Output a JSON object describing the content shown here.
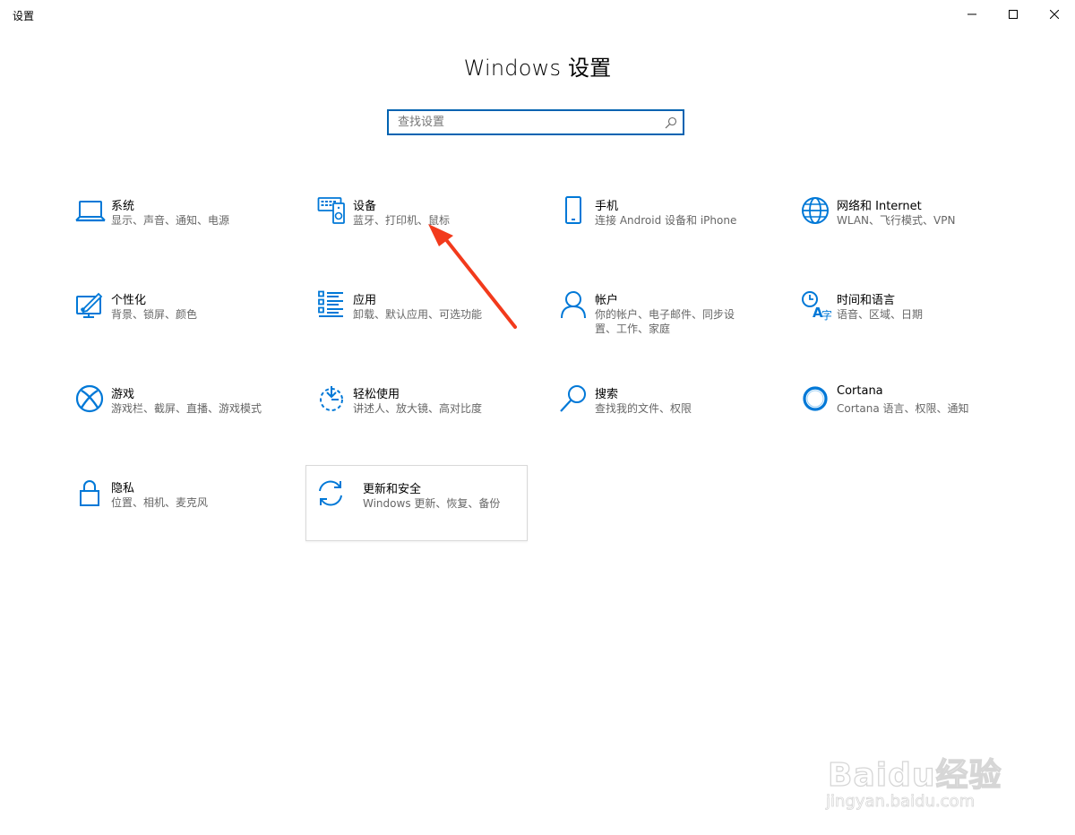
{
  "window": {
    "app_title": "设置"
  },
  "header": {
    "title": "Windows 设置"
  },
  "search": {
    "placeholder": "查找设置",
    "value": ""
  },
  "tiles": [
    {
      "title": "系统",
      "desc": "显示、声音、通知、电源",
      "icon": "laptop-icon"
    },
    {
      "title": "设备",
      "desc": "蓝牙、打印机、鼠标",
      "icon": "devices-icon"
    },
    {
      "title": "手机",
      "desc": "连接 Android 设备和 iPhone",
      "icon": "phone-icon"
    },
    {
      "title": "网络和 Internet",
      "desc": "WLAN、飞行模式、VPN",
      "icon": "globe-icon"
    },
    {
      "title": "个性化",
      "desc": "背景、锁屏、颜色",
      "icon": "personalization-icon"
    },
    {
      "title": "应用",
      "desc": "卸载、默认应用、可选功能",
      "icon": "apps-list-icon"
    },
    {
      "title": "帐户",
      "desc": "你的帐户、电子邮件、同步设置、工作、家庭",
      "icon": "person-icon"
    },
    {
      "title": "时间和语言",
      "desc": "语音、区域、日期",
      "icon": "time-language-icon"
    },
    {
      "title": "游戏",
      "desc": "游戏栏、截屏、直播、游戏模式",
      "icon": "xbox-icon"
    },
    {
      "title": "轻松使用",
      "desc": "讲述人、放大镜、高对比度",
      "icon": "ease-of-access-icon"
    },
    {
      "title": "搜索",
      "desc": "查找我的文件、权限",
      "icon": "magnifier-icon"
    },
    {
      "title": "Cortana",
      "desc": "Cortana 语言、权限、通知",
      "icon": "cortana-icon"
    },
    {
      "title": "隐私",
      "desc": "位置、相机、麦克风",
      "icon": "lock-icon"
    },
    {
      "title": "更新和安全",
      "desc": "Windows 更新、恢复、备份",
      "icon": "sync-icon"
    }
  ],
  "watermark": {
    "brand": "Baidu经验",
    "url": "jingyan.baidu.com"
  },
  "colors": {
    "accent": "#0063b1",
    "icon_blue": "#0078d7",
    "arrow_red": "#f23a1c"
  }
}
